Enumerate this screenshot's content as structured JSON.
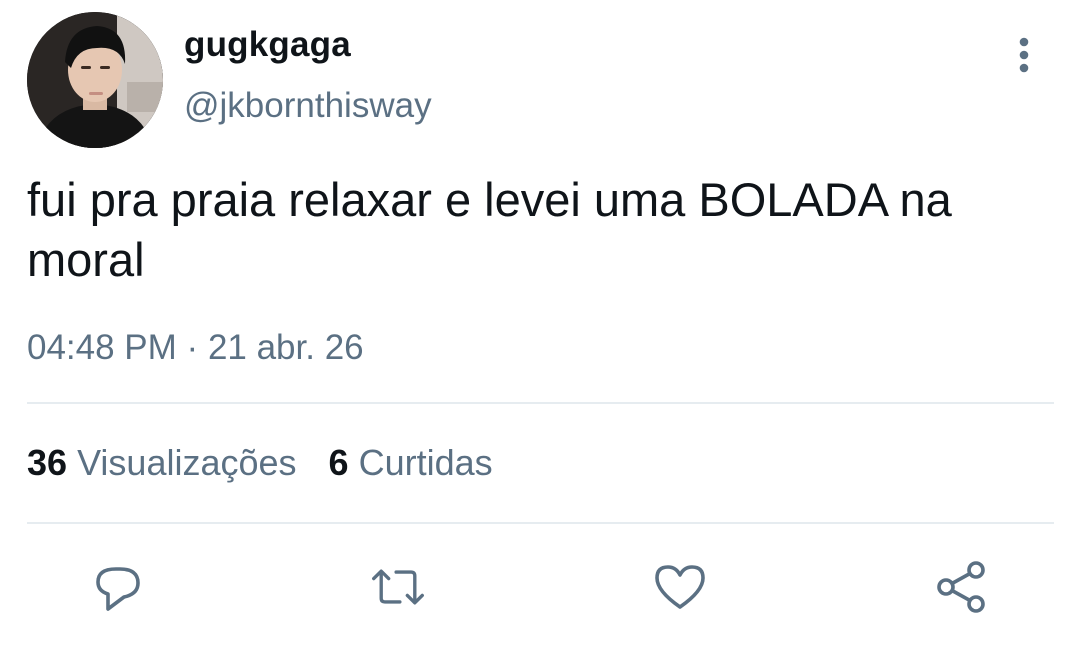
{
  "user": {
    "display_name": "gugkgaga",
    "handle": "@jkbornthisway"
  },
  "tweet": {
    "text": "fui pra praia relaxar e levei uma BOLADA na moral",
    "time": "04:48 PM",
    "separator": "·",
    "date": "21 abr. 26"
  },
  "stats": {
    "views_count": "36",
    "views_label": "Visualizações",
    "likes_count": "6",
    "likes_label": "Curtidas"
  },
  "actions": [
    "reply-icon",
    "retweet-icon",
    "like-icon",
    "share-icon"
  ],
  "colors": {
    "text": "#0f1419",
    "secondary": "#5b7083",
    "divider": "#e6ecf0"
  }
}
